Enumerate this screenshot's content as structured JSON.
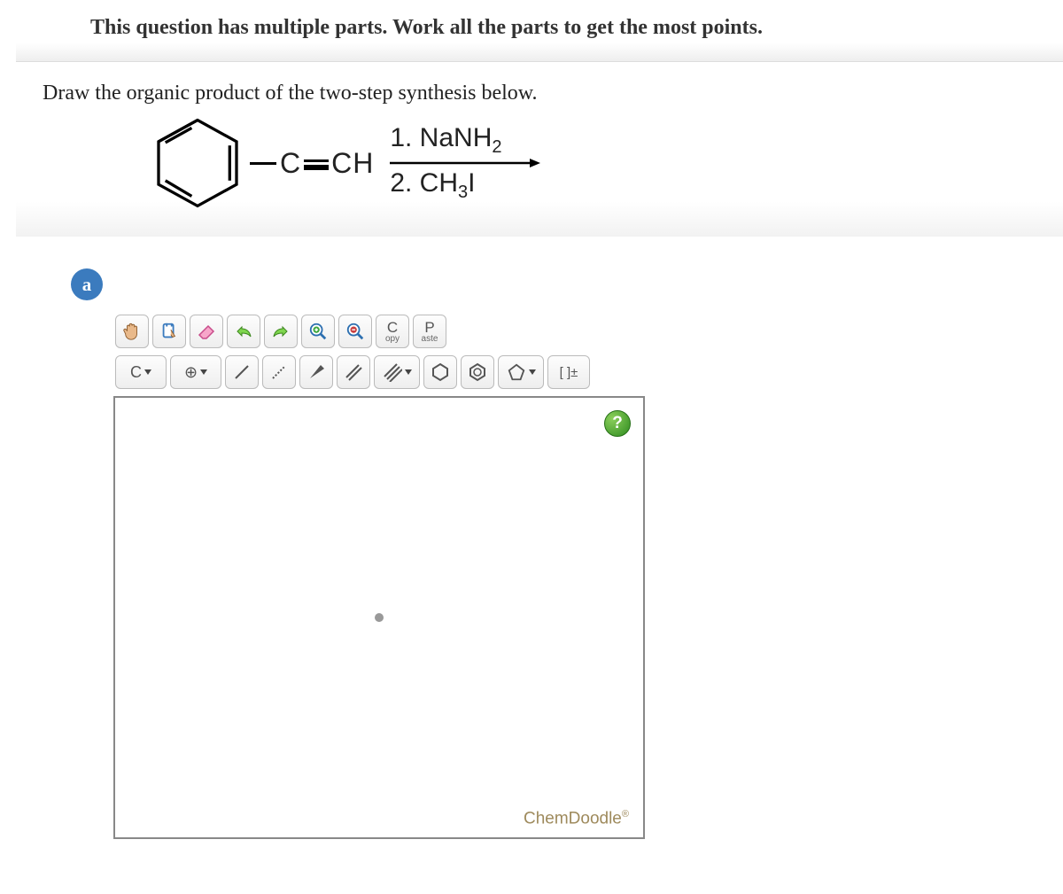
{
  "banner": "This question has multiple parts. Work all the parts to get the most points.",
  "question": "Draw the organic product of the two-step synthesis below.",
  "reaction": {
    "starting_material": {
      "ring": "benzene",
      "substituent": "C≡CH"
    },
    "step1": "1. NaNH",
    "step1_sub": "2",
    "step2": "2. CH",
    "step2_sub": "3",
    "step2_after": "I"
  },
  "part_label": "a",
  "toolbar1": {
    "hand_name": "hand-icon",
    "lasso_name": "lasso-icon",
    "eraser_name": "eraser-icon",
    "undo_name": "undo-icon",
    "redo_name": "redo-icon",
    "zoom_in_name": "zoom-in-icon",
    "zoom_out_name": "zoom-out-icon",
    "copy_top": "C",
    "copy_sub": "opy",
    "paste_top": "P",
    "paste_sub": "aste"
  },
  "toolbar2": {
    "element_label": "C",
    "charge_label": "⊕",
    "bond_single_name": "single-bond-icon",
    "bond_dashed_name": "dashed-bond-icon",
    "bond_wedge_name": "wedge-bond-icon",
    "bond_double_name": "double-bond-icon",
    "bond_triple_name": "triple-bond-icon",
    "ring6_name": "hexagon-ring-icon",
    "ring6b_name": "benzene-ring-icon",
    "ring5_name": "pentagon-ring-icon",
    "bracket_label": "[ ]±"
  },
  "help_label": "?",
  "brand": "ChemDoodle",
  "brand_mark": "®"
}
